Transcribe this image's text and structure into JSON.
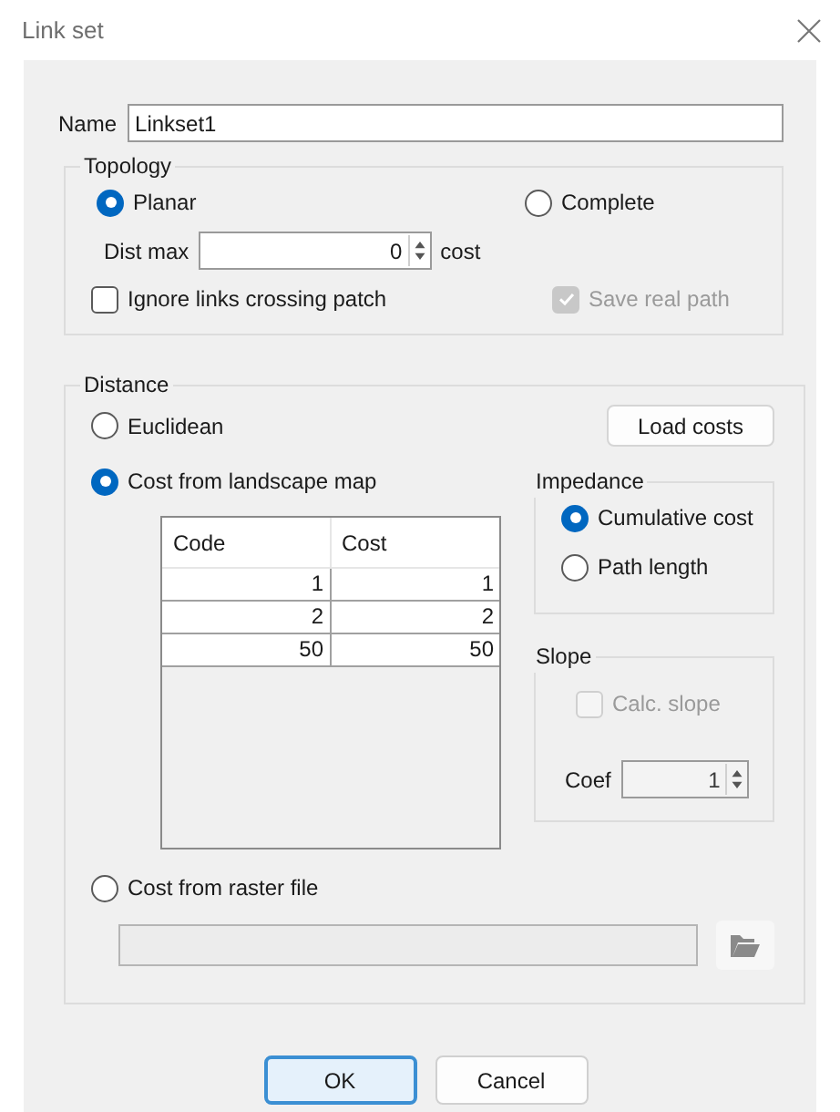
{
  "window": {
    "title": "Link set"
  },
  "name": {
    "label": "Name",
    "value": "Linkset1"
  },
  "topology": {
    "title": "Topology",
    "options": [
      {
        "label": "Planar",
        "selected": true
      },
      {
        "label": "Complete",
        "selected": false
      }
    ],
    "dist_max": {
      "label": "Dist max",
      "value": "0",
      "unit": "cost"
    },
    "ignore_links": {
      "label": "Ignore links crossing patch",
      "checked": false,
      "disabled": false
    },
    "save_real_path": {
      "label": "Save real path",
      "checked": true,
      "disabled": true
    }
  },
  "distance": {
    "title": "Distance",
    "options": [
      {
        "label": "Euclidean",
        "selected": false
      },
      {
        "label": "Cost from landscape map",
        "selected": true
      },
      {
        "label": "Cost from raster file",
        "selected": false
      }
    ],
    "load_costs": "Load costs",
    "table": {
      "columns": [
        "Code",
        "Cost"
      ],
      "rows": [
        [
          "1",
          "1"
        ],
        [
          "2",
          "2"
        ],
        [
          "50",
          "50"
        ]
      ]
    },
    "impedance": {
      "title": "Impedance",
      "options": [
        {
          "label": "Cumulative cost",
          "selected": true
        },
        {
          "label": "Path length",
          "selected": false
        }
      ]
    },
    "slope": {
      "title": "Slope",
      "calc_slope": {
        "label": "Calc. slope",
        "checked": false,
        "disabled": true
      },
      "coef": {
        "label": "Coef",
        "value": "1",
        "disabled": true
      }
    }
  },
  "buttons": [
    {
      "label": "OK",
      "default": true
    },
    {
      "label": "Cancel",
      "default": false
    }
  ]
}
